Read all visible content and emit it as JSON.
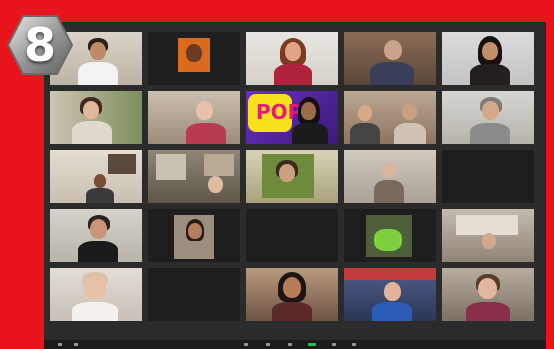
{
  "badge": {
    "number": "8"
  },
  "colors": {
    "frame_red": "#e8141b",
    "window_bg": "#2b2b2b",
    "active_speaker": "#9be84a",
    "share_green": "#2ec24a"
  },
  "tiles": [
    {
      "kind": "video",
      "name": ""
    },
    {
      "kind": "video",
      "name": ""
    },
    {
      "kind": "video",
      "name": ""
    },
    {
      "kind": "video",
      "name": ""
    },
    {
      "kind": "video",
      "name": ""
    },
    {
      "kind": "video",
      "name": ""
    },
    {
      "kind": "video",
      "name": ""
    },
    {
      "kind": "video",
      "name": ""
    },
    {
      "kind": "video",
      "name": ""
    },
    {
      "kind": "video",
      "name": ""
    },
    {
      "kind": "video",
      "name": ""
    },
    {
      "kind": "video",
      "name": ""
    },
    {
      "kind": "video",
      "name": ""
    },
    {
      "kind": "video",
      "name": ""
    },
    {
      "kind": "name",
      "name": ""
    },
    {
      "kind": "video",
      "name": ""
    },
    {
      "kind": "video",
      "name": ""
    },
    {
      "kind": "name",
      "name": ""
    },
    {
      "kind": "video",
      "name": ""
    },
    {
      "kind": "video",
      "name": ""
    },
    {
      "kind": "video",
      "name": ""
    },
    {
      "kind": "name",
      "name": ""
    },
    {
      "kind": "video",
      "name": ""
    },
    {
      "kind": "video",
      "name": ""
    },
    {
      "kind": "video",
      "name": ""
    }
  ],
  "toolbar": {
    "icons": [
      "mute-icon",
      "video-icon",
      "security-icon",
      "participants-icon",
      "chat-icon",
      "share-screen-icon",
      "record-icon",
      "reactions-icon"
    ]
  }
}
